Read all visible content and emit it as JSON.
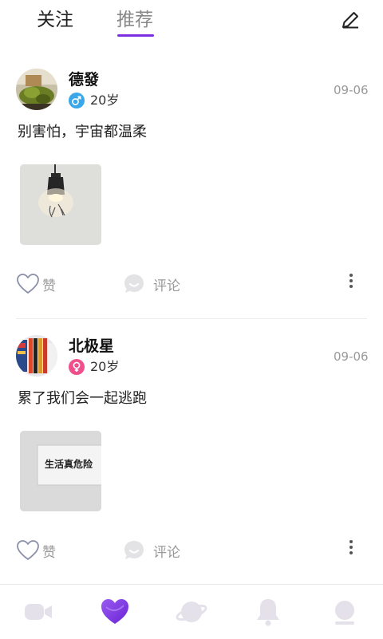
{
  "tabs": {
    "follow_label": "关注",
    "recommend_label": "推荐"
  },
  "posts": [
    {
      "username": "德發",
      "gender": "male",
      "age": "20岁",
      "date": "09-06",
      "text": "别害怕，宇宙都温柔",
      "like_label": "赞",
      "comment_label": "评论"
    },
    {
      "username": "北极星",
      "gender": "female",
      "age": "20岁",
      "date": "09-06",
      "text": "累了我们会一起逃跑",
      "photo_sign_text": "生活真危险",
      "like_label": "赞",
      "comment_label": "评论"
    }
  ],
  "bottom_nav": [
    "video-icon",
    "heart-icon",
    "planet-icon",
    "bell-icon",
    "profile-icon"
  ],
  "colors": {
    "accent": "#7a2fe0",
    "male": "#3aa8e8",
    "female": "#ef4f8c",
    "muted": "#999999"
  }
}
